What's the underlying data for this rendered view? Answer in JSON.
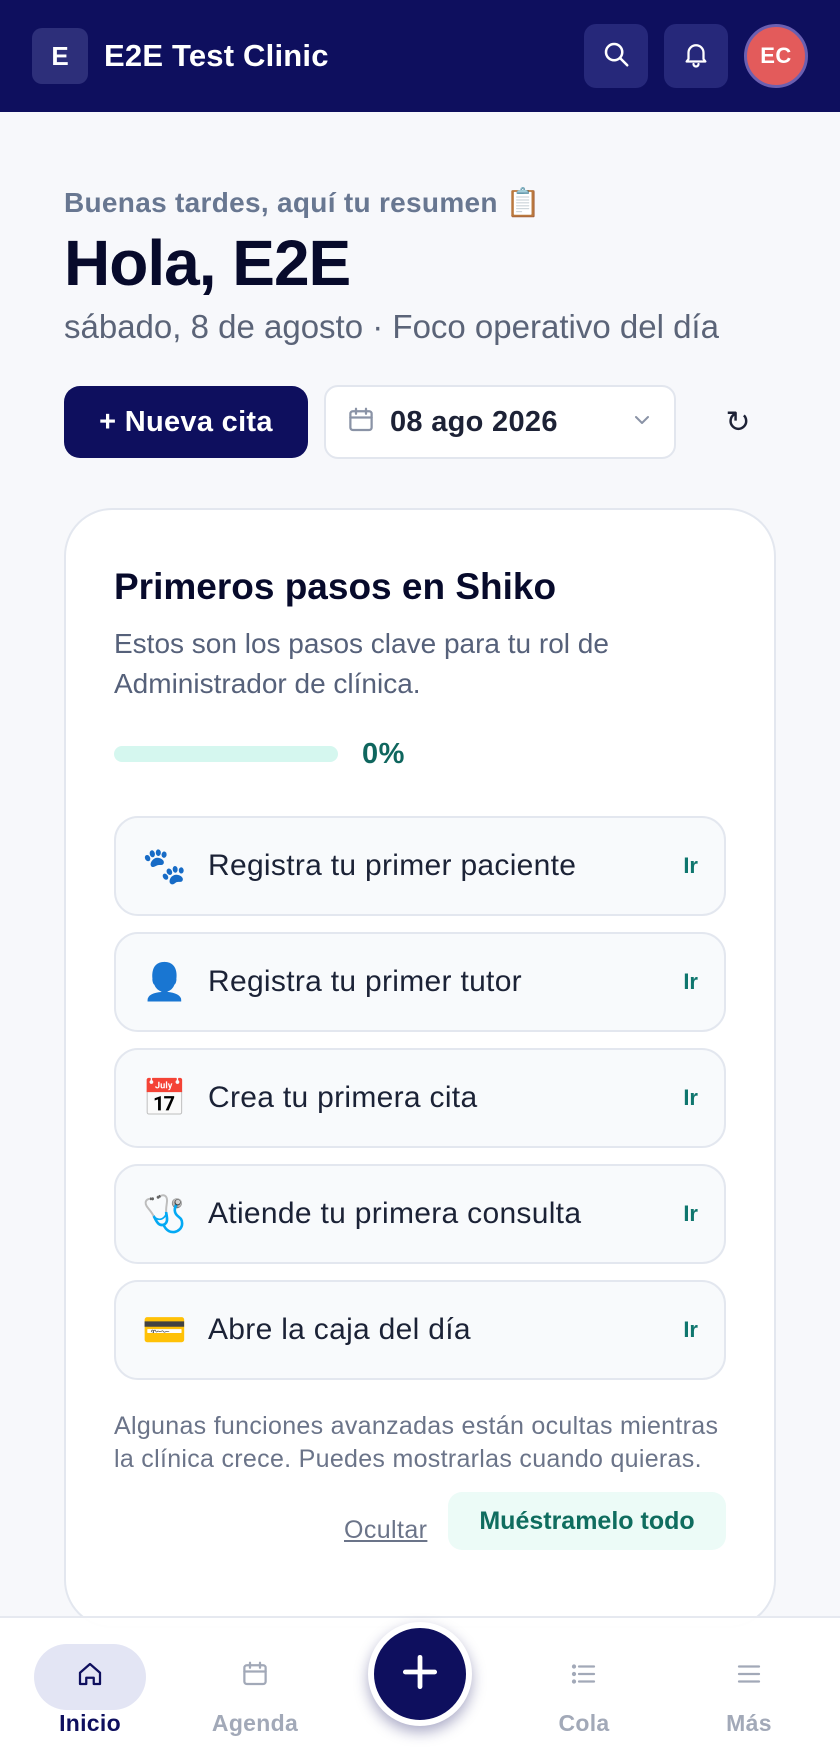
{
  "header": {
    "logo_letter": "E",
    "app_title": "E2E Test Clinic",
    "avatar_initials": "EC",
    "icons": [
      "search-icon",
      "bell-icon"
    ]
  },
  "greeting": {
    "subtitle": "Buenas tardes, aquí tu resumen 📋",
    "title": "Hola, E2E",
    "date_line": "sábado, 8 de agosto · Foco operativo del día"
  },
  "toolbar": {
    "new_appointment_label": "+ Nueva cita",
    "date_value": "08 ago 2026",
    "refresh_glyph": "↻"
  },
  "onboarding": {
    "title": "Primeros pasos en Shiko",
    "description": "Estos son los pasos clave para tu rol de Administrador de clínica.",
    "progress_percent": 0,
    "progress_label": "0%",
    "steps": [
      {
        "icon": "🐾",
        "label": "Registra tu primer paciente",
        "action": "Ir"
      },
      {
        "icon": "👤",
        "label": "Registra tu primer tutor",
        "action": "Ir"
      },
      {
        "icon": "📅",
        "label": "Crea tu primera cita",
        "action": "Ir"
      },
      {
        "icon": "🩺",
        "label": "Atiende tu primera consulta",
        "action": "Ir"
      },
      {
        "icon": "💳",
        "label": "Abre la caja del día",
        "action": "Ir"
      }
    ],
    "note": "Algunas funciones avanzadas están ocultas mientras la clínica crece. Puedes mostrarlas cuando quieras.",
    "hide_label": "Ocultar",
    "show_all_label": "Muéstramelo todo"
  },
  "bottom_nav": {
    "items": [
      {
        "label": "Inicio",
        "icon": "home-icon",
        "active": true
      },
      {
        "label": "Agenda",
        "icon": "calendar-icon",
        "active": false
      },
      {
        "label": "Cola",
        "icon": "list-icon",
        "active": false
      },
      {
        "label": "Más",
        "icon": "menu-icon",
        "active": false
      }
    ],
    "fab_icon": "plus-icon"
  },
  "colors": {
    "primary": "#0e0f5e",
    "accent_teal": "#0f766e",
    "avatar": "#e35b5b",
    "background": "#f7f8fb"
  }
}
